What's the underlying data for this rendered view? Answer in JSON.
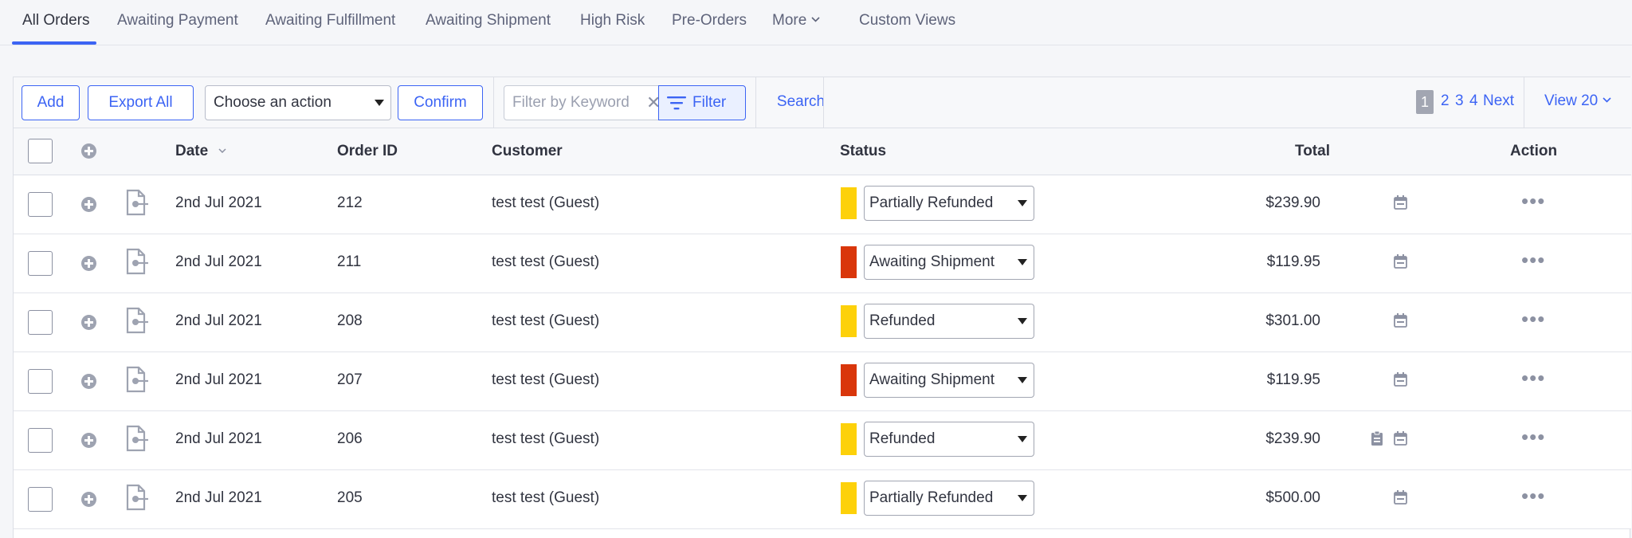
{
  "tabs": [
    {
      "label": "All Orders",
      "active": true
    },
    {
      "label": "Awaiting Payment"
    },
    {
      "label": "Awaiting Fulfillment"
    },
    {
      "label": "Awaiting Shipment"
    },
    {
      "label": "High Risk"
    },
    {
      "label": "Pre-Orders"
    },
    {
      "label": "More"
    },
    {
      "label": "Custom Views"
    }
  ],
  "toolbar": {
    "add_label": "Add",
    "export_label": "Export All",
    "action_select": "Choose an action",
    "confirm_label": "Confirm",
    "filter_placeholder": "Filter by Keyword",
    "filter_label": "Filter",
    "search_label": "Search"
  },
  "pagination": {
    "current": "1",
    "pages": [
      "2",
      "3",
      "4"
    ],
    "next_label": "Next",
    "view_label": "View 20"
  },
  "table": {
    "headers": {
      "date": "Date",
      "order_id": "Order ID",
      "customer": "Customer",
      "status": "Status",
      "total": "Total",
      "action": "Action"
    },
    "rows": [
      {
        "date": "2nd Jul 2021",
        "order_id": "212",
        "customer": "test test (Guest)",
        "status": "Partially Refunded",
        "status_color": "#fdd10a",
        "total": "$239.90",
        "has_note": false
      },
      {
        "date": "2nd Jul 2021",
        "order_id": "211",
        "customer": "test test (Guest)",
        "status": "Awaiting Shipment",
        "status_color": "#d9360b",
        "total": "$119.95",
        "has_note": false
      },
      {
        "date": "2nd Jul 2021",
        "order_id": "208",
        "customer": "test test (Guest)",
        "status": "Refunded",
        "status_color": "#fdd10a",
        "total": "$301.00",
        "has_note": false
      },
      {
        "date": "2nd Jul 2021",
        "order_id": "207",
        "customer": "test test (Guest)",
        "status": "Awaiting Shipment",
        "status_color": "#d9360b",
        "total": "$119.95",
        "has_note": false
      },
      {
        "date": "2nd Jul 2021",
        "order_id": "206",
        "customer": "test test (Guest)",
        "status": "Refunded",
        "status_color": "#fdd10a",
        "total": "$239.90",
        "has_note": true
      },
      {
        "date": "2nd Jul 2021",
        "order_id": "205",
        "customer": "test test (Guest)",
        "status": "Partially Refunded",
        "status_color": "#fdd10a",
        "total": "$500.00",
        "has_note": false
      }
    ]
  },
  "colors": {
    "accent": "#3c64f4",
    "status_yellow": "#fdd10a",
    "status_red": "#d9360b"
  }
}
